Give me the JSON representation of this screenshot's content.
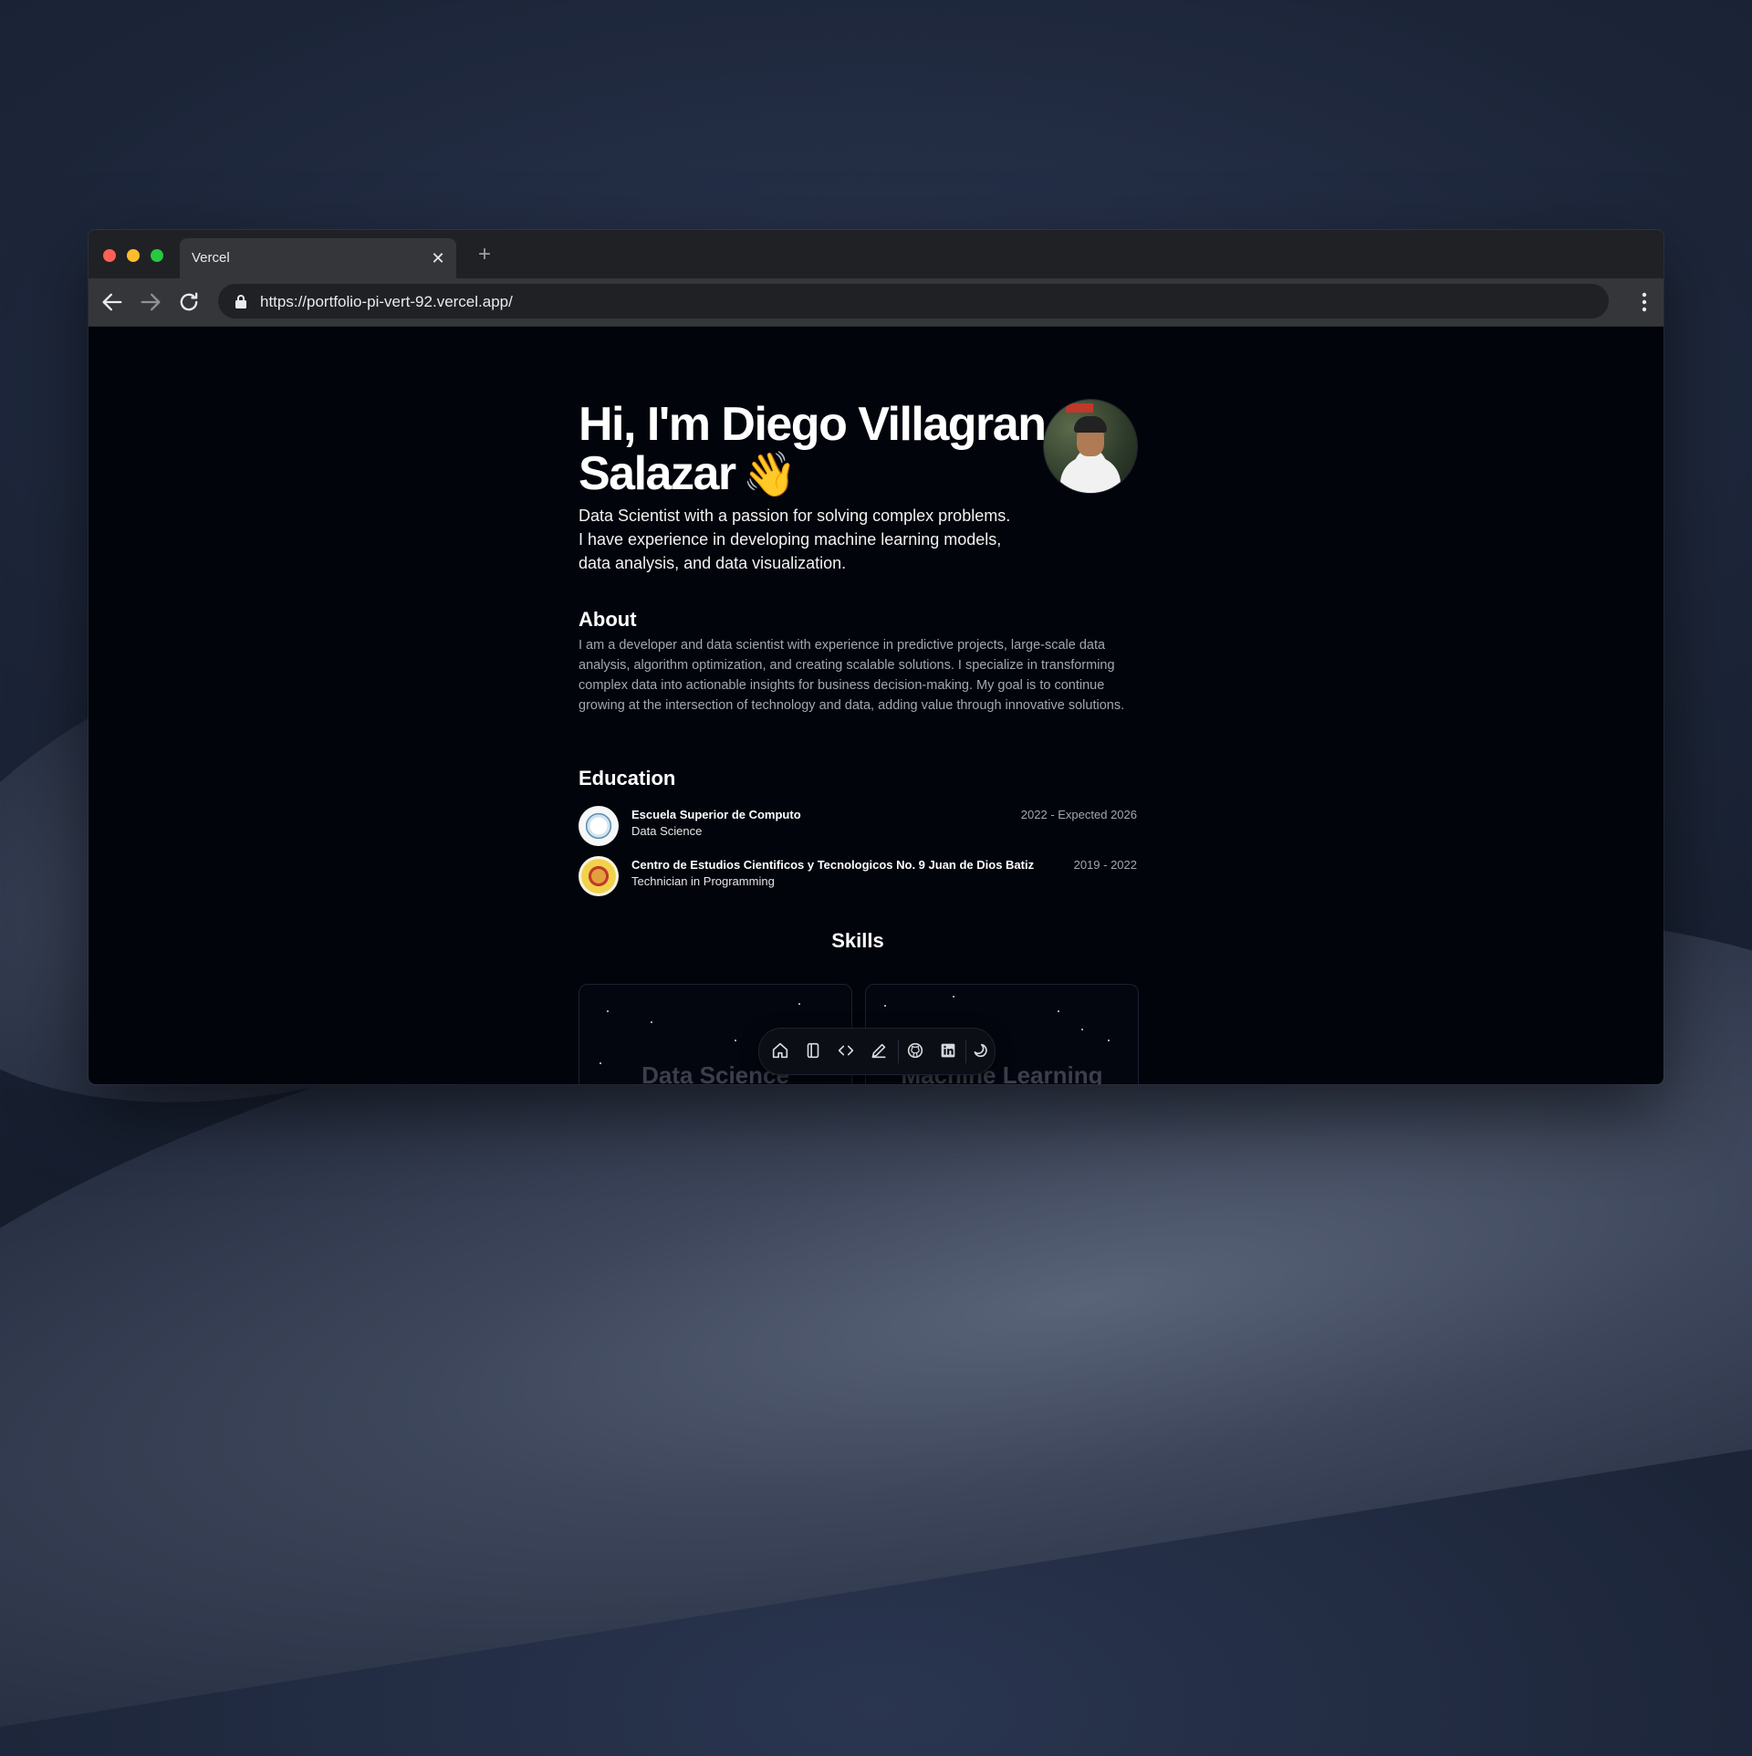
{
  "browser": {
    "tab_title": "Vercel",
    "url": "https://portfolio-pi-vert-92.vercel.app/"
  },
  "hero": {
    "title": "Hi, I'm Diego Villagran Salazar",
    "wave_emoji": "👋",
    "subtitle": "Data Scientist with a passion for solving complex problems. I have experience in developing machine learning models, data analysis, and data visualization."
  },
  "about": {
    "heading": "About",
    "text": "I am a developer and data scientist with experience in predictive projects, large-scale data analysis, algorithm optimization, and creating scalable solutions. I specialize in transforming complex data into actionable insights for business decision-making. My goal is to continue growing at the intersection of technology and data, adding value through innovative solutions."
  },
  "education": {
    "heading": "Education",
    "items": [
      {
        "school": "Escuela Superior de Computo",
        "degree": "Data Science",
        "dates": "2022 - Expected 2026",
        "logo_label": "ESCOM"
      },
      {
        "school": "Centro de Estudios Cientificos y Tecnologicos No. 9 Juan de Dios Batiz",
        "degree": "Technician in Programming",
        "dates": "2019 - 2022"
      }
    ]
  },
  "skills": {
    "heading": "Skills",
    "cards": [
      {
        "name": "Data Science"
      },
      {
        "name": "Machine Learning"
      }
    ]
  },
  "dock": {
    "icons": [
      "home-icon",
      "notebook-icon",
      "code-icon",
      "pencil-icon",
      "github-icon",
      "linkedin-icon",
      "theme-toggle-icon"
    ]
  },
  "colors": {
    "page_bg": "#02040c",
    "text_primary": "#ffffff",
    "text_muted": "#a3a7b0",
    "chrome_tabbar": "#202124",
    "chrome_toolbar": "#35363a"
  }
}
